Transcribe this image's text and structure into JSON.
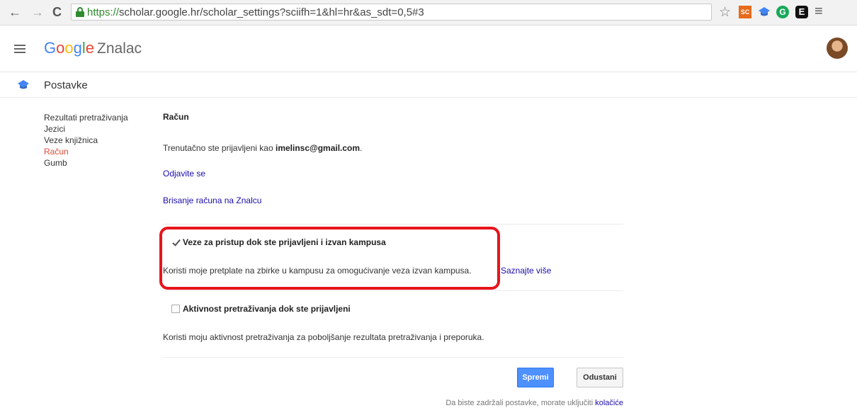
{
  "browser": {
    "url_protocol": "https://",
    "url_rest": "scholar.google.hr/scholar_settings?sciifh=1&hl=hr&as_sdt=0,5#3",
    "icons": [
      "back-arrow-icon",
      "forward-arrow-icon",
      "reload-icon",
      "lock-icon",
      "star-icon",
      "sc-extension-icon",
      "scholar-cap-extension-icon",
      "grammarly-icon",
      "evernote-icon",
      "browser-menu-icon"
    ],
    "sc_label": "SC",
    "g_label": "G",
    "e_label": "E"
  },
  "header": {
    "brand_g1": "G",
    "brand_g2": "o",
    "brand_g3": "o",
    "brand_g4": "g",
    "brand_g5": "l",
    "brand_g6": "e",
    "product": "Znalac"
  },
  "settings": {
    "title": "Postavke"
  },
  "leftnav": {
    "items": [
      {
        "label": "Rezultati pretraživanja",
        "active": false
      },
      {
        "label": "Jezici",
        "active": false
      },
      {
        "label": "Veze knjižnica",
        "active": false
      },
      {
        "label": "Račun",
        "active": true
      },
      {
        "label": "Gumb",
        "active": false
      }
    ]
  },
  "account": {
    "section_title": "Račun",
    "signed_in_prefix": "Trenutačno ste prijavljeni kao ",
    "email": "imelinsc@gmail.com",
    "signed_in_suffix": ".",
    "signout_link": "Odjavite se",
    "delete_link": "Brisanje računa na Znalcu"
  },
  "options": [
    {
      "label": "Veze za pristup dok ste prijavljeni i izvan kampusa",
      "checked": true,
      "description": "Koristi moje pretplate na zbirke u kampusu za omogućivanje veza izvan kampusa.",
      "learn_more": "Saznajte više"
    },
    {
      "label": "Aktivnost pretraživanja dok ste prijavljeni",
      "checked": false,
      "description": "Koristi moju aktivnost pretraživanja za poboljšanje rezultata pretraživanja i preporuka."
    }
  ],
  "buttons": {
    "save": "Spremi",
    "cancel": "Odustani"
  },
  "footer": {
    "cookies_prefix": "Da biste zadržali postavke, morate uključiti ",
    "cookies_link": "kolačiće"
  },
  "colors": {
    "highlight": "#e8141b",
    "link": "#1a0dab",
    "active_nav": "#dd4b39",
    "primary_button": "#4d90fe"
  }
}
